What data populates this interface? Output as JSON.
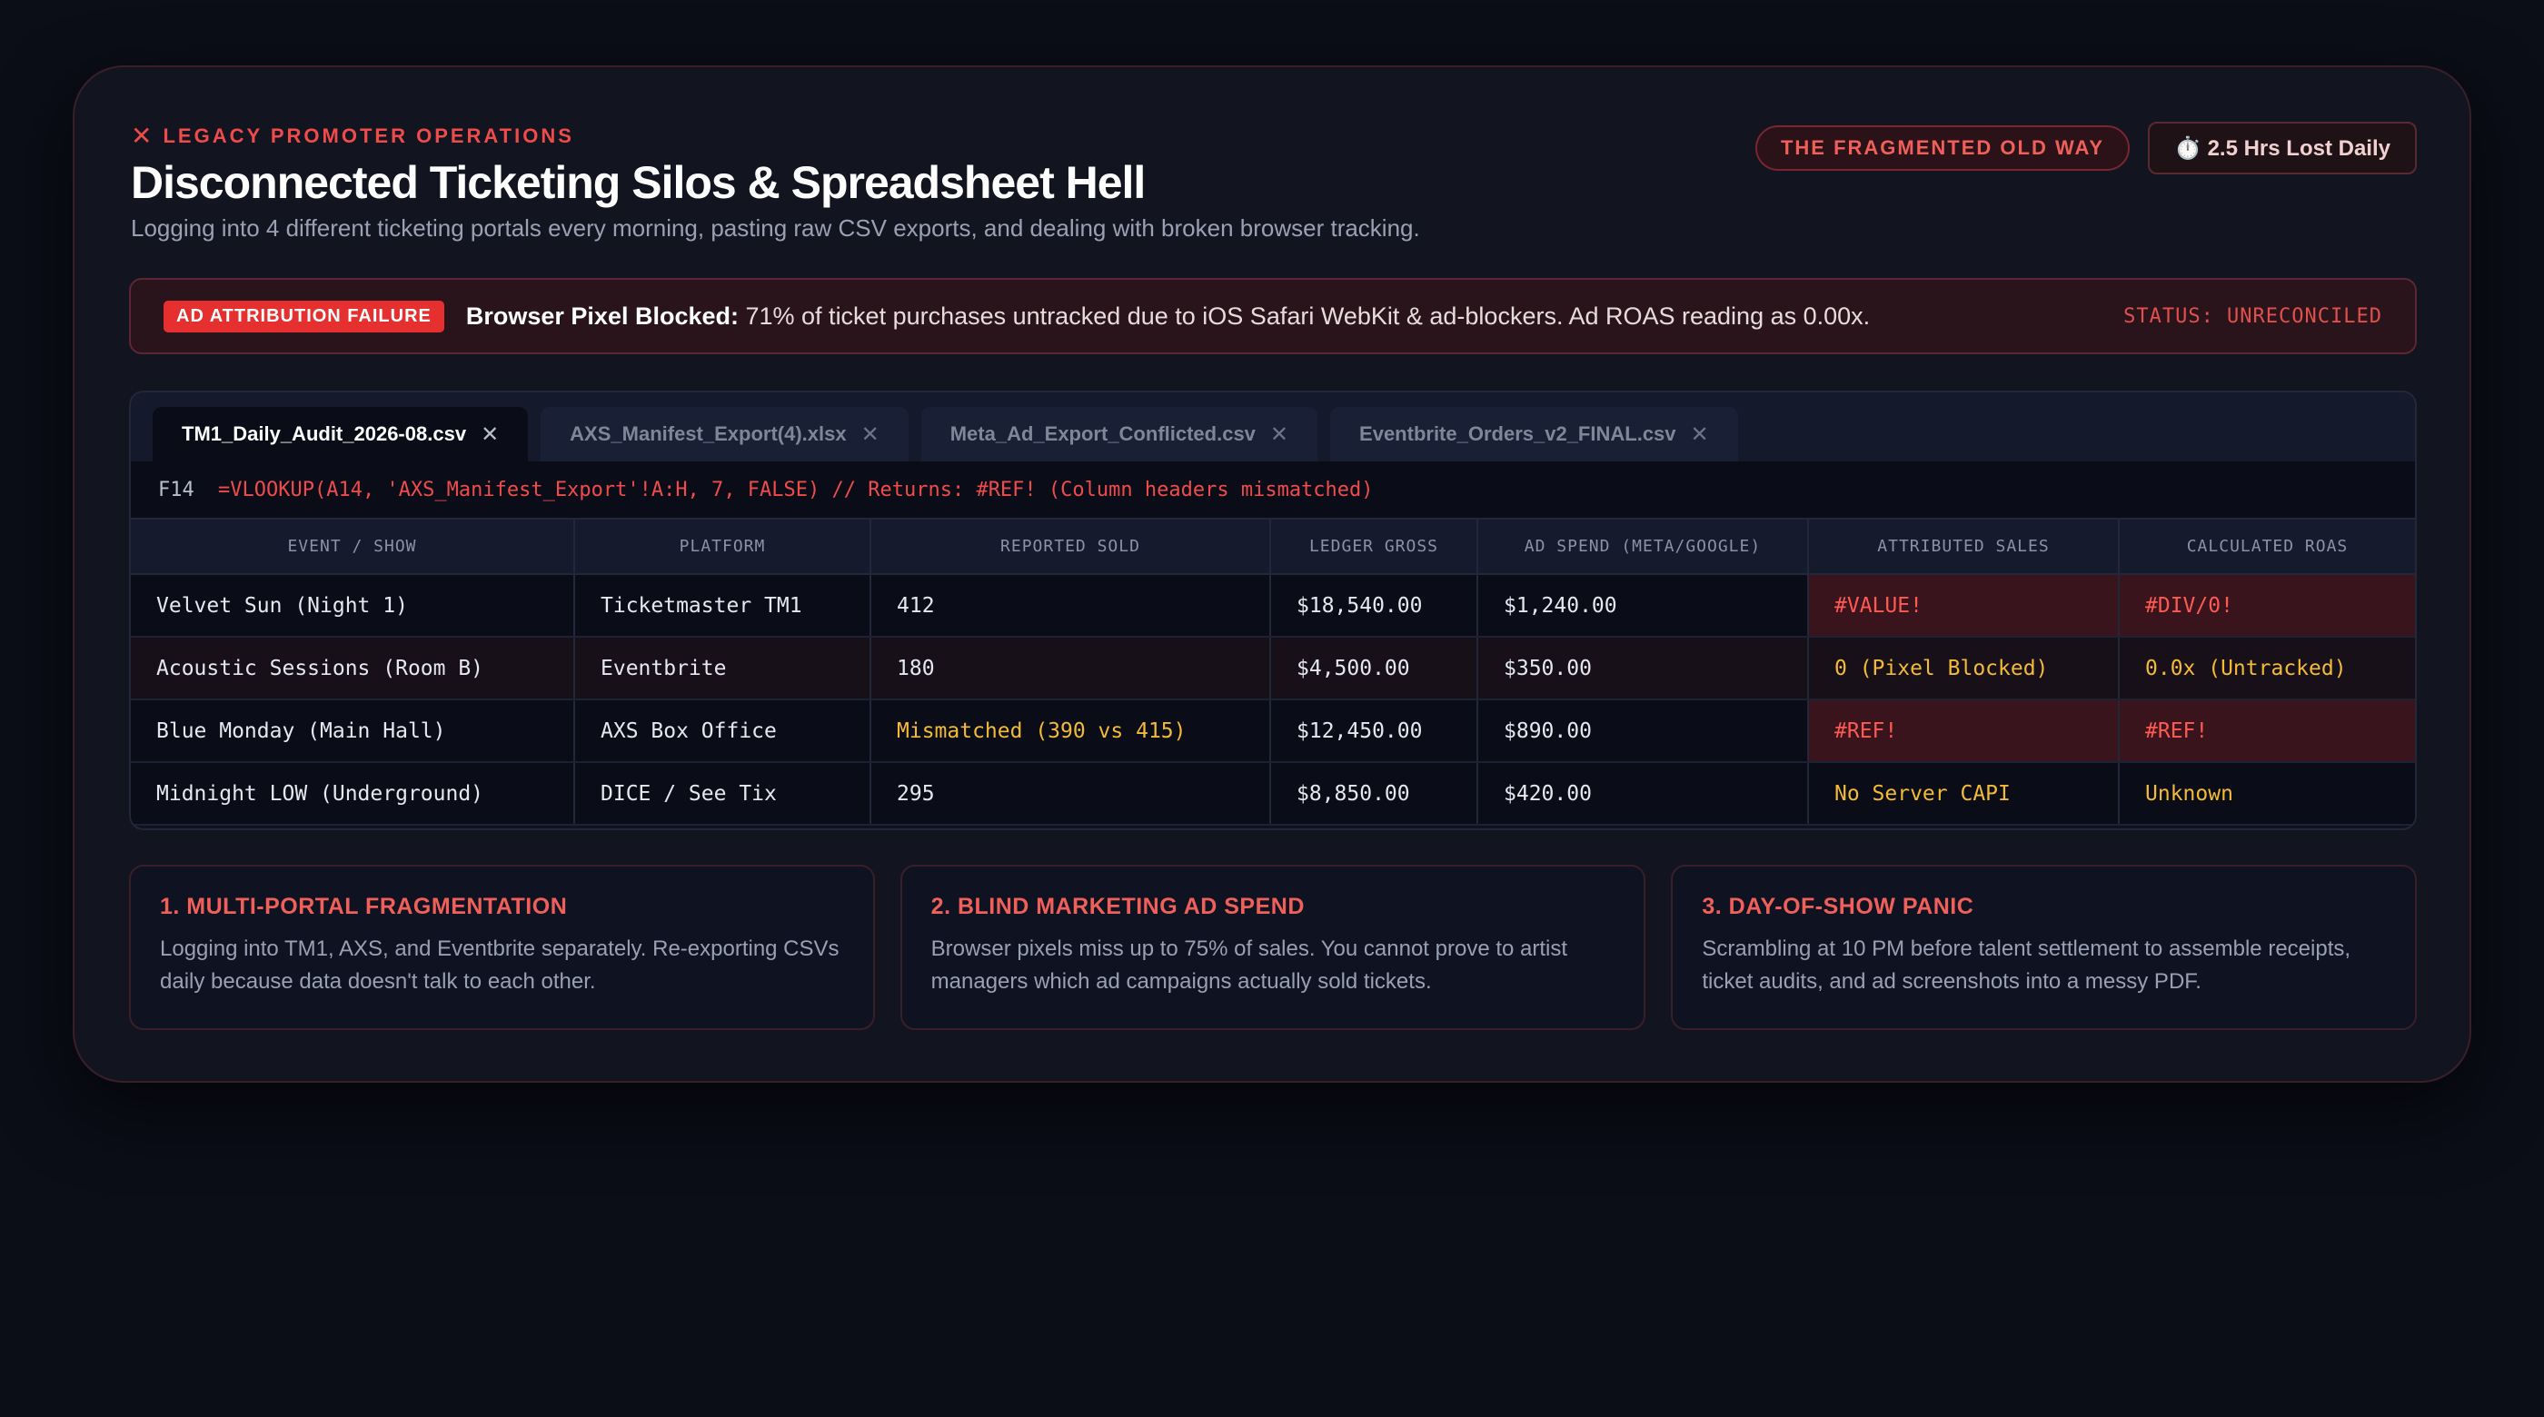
{
  "header": {
    "eyebrow": "LEGACY PROMOTER OPERATIONS",
    "eyebrow_icon": "close-x-icon",
    "title": "Disconnected Ticketing Silos & Spreadsheet Hell",
    "subtitle": "Logging into 4 different ticketing portals every morning, pasting raw CSV exports, and dealing with broken browser tracking.",
    "badge_old_way": "THE FRAGMENTED OLD WAY",
    "badge_time_lost": "⏱️ 2.5 Hrs Lost Daily"
  },
  "alert": {
    "badge": "AD ATTRIBUTION FAILURE",
    "title": "Browser Pixel Blocked:",
    "message": " 71% of ticket purchases untracked due to iOS Safari WebKit & ad-blockers. Ad ROAS reading as 0.00x.",
    "status": "STATUS: UNRECONCILED"
  },
  "tabs": [
    {
      "label": "TM1_Daily_Audit_2026-08.csv",
      "active": true
    },
    {
      "label": "AXS_Manifest_Export(4).xlsx",
      "active": false
    },
    {
      "label": "Meta_Ad_Export_Conflicted.csv",
      "active": false
    },
    {
      "label": "Eventbrite_Orders_v2_FINAL.csv",
      "active": false
    }
  ],
  "formula_bar": {
    "cell": "F14",
    "expression": "=VLOOKUP(A14, 'AXS_Manifest_Export'!A:H, 7, FALSE) // Returns: #REF! (Column headers mismatched)"
  },
  "table": {
    "columns": [
      "EVENT / SHOW",
      "PLATFORM",
      "REPORTED SOLD",
      "LEDGER GROSS",
      "AD SPEND (META/GOOGLE)",
      "ATTRIBUTED SALES",
      "CALCULATED ROAS"
    ],
    "rows": [
      [
        "Velvet Sun (Night 1)",
        "Ticketmaster TM1",
        "412",
        "$18,540.00",
        "$1,240.00",
        "#VALUE!",
        "#DIV/0!"
      ],
      [
        "Acoustic Sessions (Room B)",
        "Eventbrite",
        "180",
        "$4,500.00",
        "$350.00",
        "0 (Pixel Blocked)",
        "0.0x (Untracked)"
      ],
      [
        "Blue Monday (Main Hall)",
        "AXS Box Office",
        "Mismatched (390 vs 415)",
        "$12,450.00",
        "$890.00",
        "#REF!",
        "#REF!"
      ],
      [
        "Midnight LOW (Underground)",
        "DICE / See Tix",
        "295",
        "$8,850.00",
        "$420.00",
        "No Server CAPI",
        "Unknown"
      ]
    ]
  },
  "features": [
    {
      "title": "1. MULTI-PORTAL FRAGMENTATION",
      "body": "Logging into TM1, AXS, and Eventbrite separately. Re-exporting CSVs daily because data doesn't talk to each other."
    },
    {
      "title": "2. BLIND MARKETING AD SPEND",
      "body": "Browser pixels miss up to 75% of sales. You cannot prove to artist managers which ad campaigns actually sold tickets."
    },
    {
      "title": "3. DAY-OF-SHOW PANIC",
      "body": "Scrambling at 10 PM before talent settlement to assemble receipts, ticket audits, and ad screenshots into a messy PDF."
    }
  ],
  "colors": {
    "accent_red": "#ef4b4b",
    "warning_amber": "#f3bb32",
    "background": "#0b0d17",
    "card": "#121520"
  }
}
